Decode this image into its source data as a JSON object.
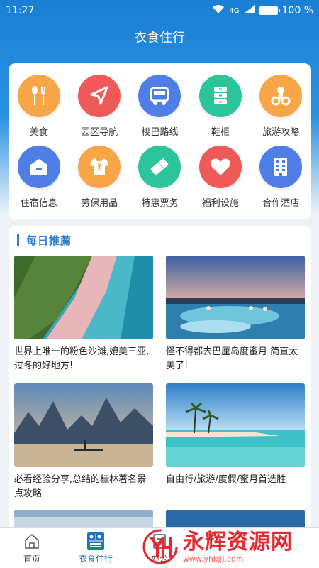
{
  "status": {
    "time": "11:27",
    "network": "4G",
    "battery": "100 %"
  },
  "header": {
    "title": "衣食住行"
  },
  "grid": {
    "items": [
      {
        "label": "美食",
        "icon": "food-icon",
        "color": "#f7a647"
      },
      {
        "label": "园区导航",
        "icon": "navigation-icon",
        "color": "#ef5a58"
      },
      {
        "label": "梭巴路线",
        "icon": "bus-icon",
        "color": "#4f7fe6"
      },
      {
        "label": "鞋柜",
        "icon": "cabinet-icon",
        "color": "#2cc59b"
      },
      {
        "label": "旅游攻略",
        "icon": "travel-icon",
        "color": "#f7a647"
      },
      {
        "label": "住宿信息",
        "icon": "house-icon",
        "color": "#4f7fe6"
      },
      {
        "label": "劳保用品",
        "icon": "shirt-icon",
        "color": "#f7a647"
      },
      {
        "label": "特惠票务",
        "icon": "ticket-icon",
        "color": "#2cc59b"
      },
      {
        "label": "福利设施",
        "icon": "heart-icon",
        "color": "#ef5a58"
      },
      {
        "label": "合作酒店",
        "icon": "hotel-icon",
        "color": "#4f7fe6"
      }
    ]
  },
  "recommend": {
    "title": "每日推薦",
    "articles": [
      {
        "caption": "世界上唯一的粉色沙滩,媲美三亚,过冬的好地方!"
      },
      {
        "caption": "怪不得都去巴厘岛度蜜月 简直太美了!"
      },
      {
        "caption": "必看经验分享,总结的桂林著名景点攻略"
      },
      {
        "caption": "自由行/旅游/度假/蜜月首选胜"
      }
    ]
  },
  "tabbar": {
    "tabs": [
      {
        "label": "首页"
      },
      {
        "label": "衣食住行"
      },
      {
        "label": "办公"
      },
      {
        "label": ""
      },
      {
        "label": ""
      }
    ]
  },
  "watermark": {
    "main": "永辉资源网",
    "sub": "www.yhkjjj.com"
  }
}
